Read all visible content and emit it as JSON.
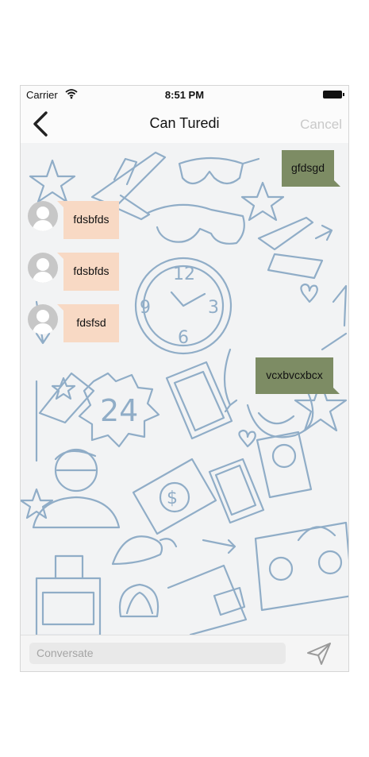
{
  "status_bar": {
    "carrier": "Carrier",
    "time": "8:51 PM"
  },
  "nav": {
    "title": "Can Turedi",
    "cancel_label": "Cancel"
  },
  "messages": [
    {
      "direction": "outgoing",
      "text": "gfdsgd"
    },
    {
      "direction": "incoming",
      "text": "fdsbfds"
    },
    {
      "direction": "incoming",
      "text": "fdsbfds"
    },
    {
      "direction": "incoming",
      "text": "fdsfsd"
    },
    {
      "direction": "outgoing",
      "text": "vcxbvcxbcx"
    }
  ],
  "composer": {
    "placeholder": "Conversate"
  },
  "icons": {
    "back": "chevron-left-icon",
    "wifi": "wifi-icon",
    "battery": "battery-icon",
    "avatar": "user-avatar-icon",
    "send": "paper-plane-icon"
  },
  "colors": {
    "outgoing_bubble": "#7d8c64",
    "incoming_bubble": "#f8d9c4",
    "doodle_stroke": "#7fa1c0",
    "cancel_text": "#c9c9c9"
  }
}
